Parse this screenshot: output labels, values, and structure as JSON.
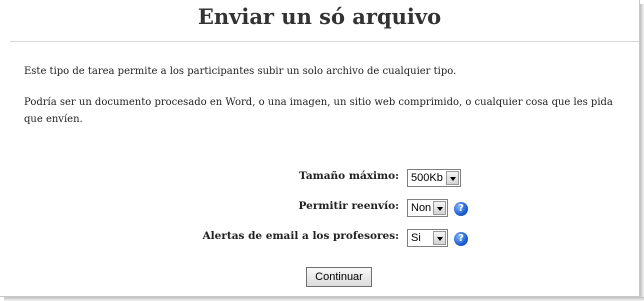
{
  "page": {
    "title": "Enviar un só arquivo",
    "description_1": "Este tipo de tarea permite a los participantes subir un solo archivo de cualquier tipo.",
    "description_2": "Podría ser un documento procesado en Word, o una imagen, un sitio web comprimido, o cualquier cosa que les pida que envíen."
  },
  "form": {
    "max_size": {
      "label": "Tamaño máximo:",
      "value": "500Kb"
    },
    "allow_resubmit": {
      "label": "Permitir reenvío:",
      "value": "Non"
    },
    "email_alerts": {
      "label": "Alertas de email a los profesores:",
      "value": "Si"
    },
    "help_glyph": "?",
    "continue_label": "Continuar"
  }
}
